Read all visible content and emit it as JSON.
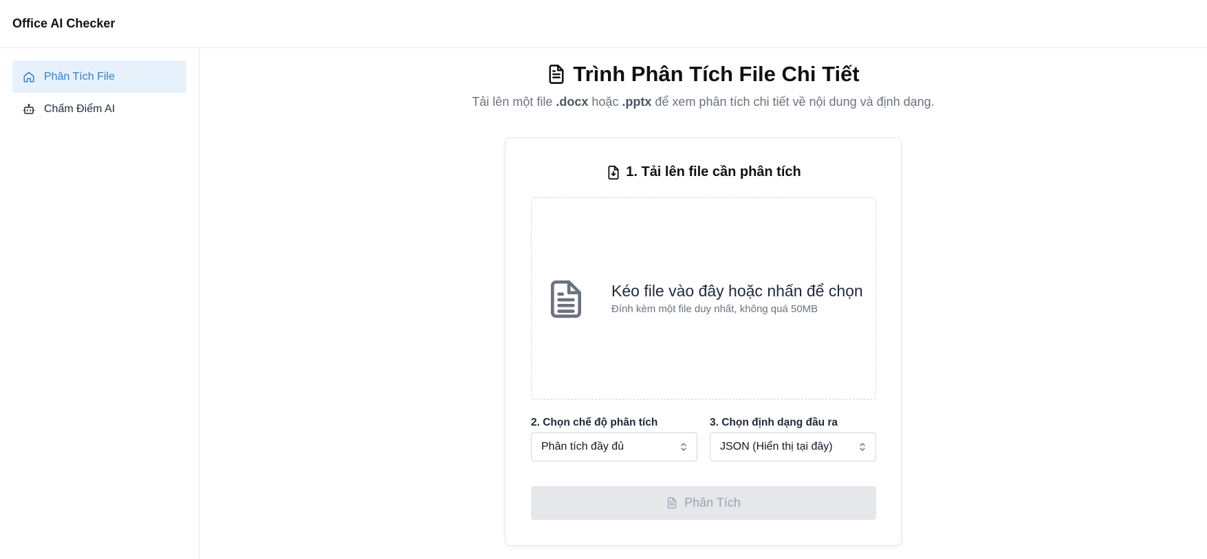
{
  "app": {
    "title": "Office AI Checker"
  },
  "sidebar": {
    "items": [
      {
        "label": "Phân Tích File",
        "icon": "home-icon",
        "active": true
      },
      {
        "label": "Chấm Điểm AI",
        "icon": "robot-icon",
        "active": false
      }
    ]
  },
  "page": {
    "title": "Trình Phân Tích File Chi Tiết",
    "title_icon": "document-icon",
    "subtitle_prefix": "Tải lên một file ",
    "subtitle_docx": ".docx",
    "subtitle_middle": " hoặc ",
    "subtitle_pptx": ".pptx",
    "subtitle_suffix": " để xem phân tích chi tiết về nội dung và định dạng."
  },
  "upload_card": {
    "heading": "1. Tải lên file cần phân tích",
    "heading_icon": "file-download-icon",
    "dropzone": {
      "main_text": "Kéo file vào đây hoặc nhấn để chọn",
      "sub_text": "Đính kèm một file duy nhất, không quá 50MB",
      "icon": "document-icon"
    },
    "analysis_mode": {
      "label": "2. Chọn chế độ phân tích",
      "selected": "Phân tích đầy đủ"
    },
    "output_format": {
      "label": "3. Chọn định dạng đầu ra",
      "selected": "JSON (Hiển thị tại đây)"
    },
    "analyze_button": {
      "label": "Phân Tích",
      "enabled": false
    }
  },
  "colors": {
    "accent": "#2f7fc7",
    "active_bg": "#e6f1fc",
    "muted_text": "#6b7280",
    "disabled_bg": "#e5e7eb",
    "disabled_text": "#9ca3af"
  }
}
